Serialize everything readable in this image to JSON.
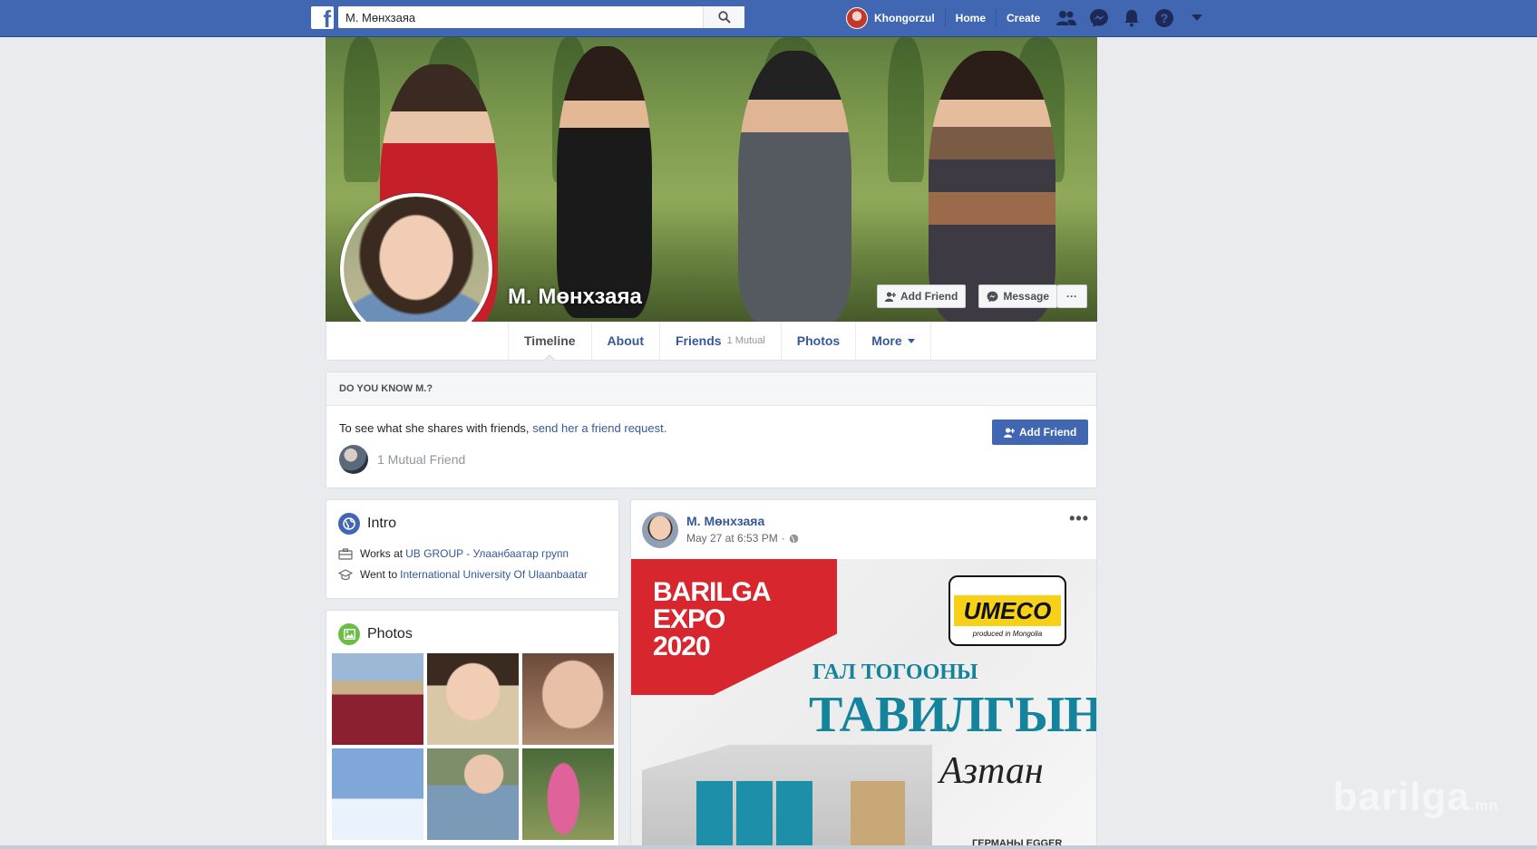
{
  "topbar": {
    "logo": "f",
    "search_value": "М. Мөнхзаяа",
    "user_name": "Khongorzul",
    "nav": [
      "Home",
      "Create"
    ],
    "icons": [
      "friends-icon",
      "messenger-icon",
      "notifications-icon",
      "help-icon",
      "account-menu-icon"
    ]
  },
  "profile": {
    "name": "М. Мөнхзаяа",
    "add_friend_label": "Add Friend",
    "message_label": "Message",
    "more_label": "···"
  },
  "tabs": {
    "timeline": "Timeline",
    "about": "About",
    "friends": "Friends",
    "friends_sub": "1 Mutual",
    "photos": "Photos",
    "more": "More"
  },
  "know": {
    "heading": "DO YOU KNOW M.?",
    "text": "To see what she shares with friends,",
    "link": "send her a friend request.",
    "mutual": "1 Mutual Friend",
    "button": "Add Friend"
  },
  "intro": {
    "title": "Intro",
    "work_prefix": "Works at",
    "work_link": "UB GROUP - Улаанбаатар групп",
    "edu_prefix": "Went to",
    "edu_link": "International University Of Ulaanbaatar"
  },
  "photos": {
    "title": "Photos"
  },
  "post": {
    "author": "М. Мөнхзаяа",
    "time": "May 27 at 6:53 PM",
    "separator": "·",
    "ad_expo": "BARILGA EXPO 2020",
    "ad_expo_l1": "BARILGA",
    "ad_expo_l2": "EXPO",
    "ad_expo_l3": "2020",
    "ad_brand": "UMECO",
    "ad_brand_sub": "produced in Mongolia",
    "ad_line1": "ГАЛ ТОГООНЫ",
    "ad_line2": "ТАВИЛГЫН",
    "ad_line3": "Азтан",
    "ad_footer": "ГЕРМАНЫ ЕGGER"
  },
  "watermark": {
    "main": "barilga",
    "suffix": ".mn"
  },
  "colors": {
    "brand": "#4267b2",
    "link": "#365899",
    "background": "#e9ebee",
    "expo_red": "#d7262e",
    "ad_teal": "#14839c",
    "umeco_yellow": "#f7d117"
  }
}
